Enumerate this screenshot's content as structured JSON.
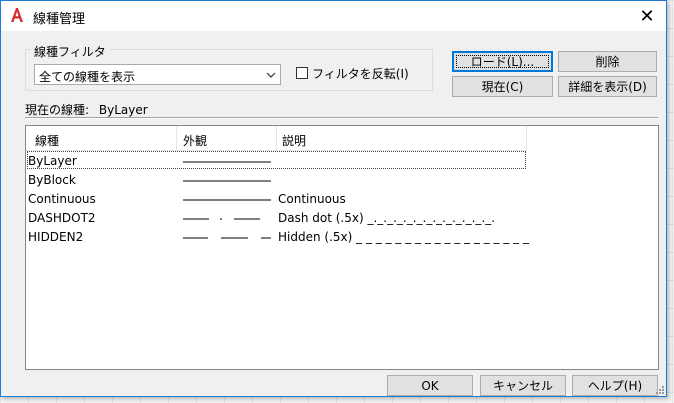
{
  "dialog": {
    "title": "線種管理",
    "close_label": "✕"
  },
  "filter": {
    "group_label": "線種フィルタ",
    "selected": "全ての線種を表示",
    "invert_label": "フィルタを反転(I)",
    "invert_checked": false
  },
  "buttons": {
    "load": "ロード(L)...",
    "delete": "削除",
    "current": "現在(C)",
    "details": "詳細を表示(D)",
    "ok": "OK",
    "cancel": "キャンセル",
    "help": "ヘルプ(H)"
  },
  "current_linetype": {
    "label": "現在の線種:",
    "value": "ByLayer"
  },
  "table": {
    "columns": [
      "線種",
      "外観",
      "説明"
    ],
    "rows": [
      {
        "name": "ByLayer",
        "look": "solid",
        "desc": ""
      },
      {
        "name": "ByBlock",
        "look": "solid",
        "desc": ""
      },
      {
        "name": "Continuous",
        "look": "solid",
        "desc": "Continuous"
      },
      {
        "name": "DASHDOT2",
        "look": "dashdot",
        "desc": "Dash dot (.5x) _._._._._._._._._._._._._."
      },
      {
        "name": "HIDDEN2",
        "look": "hidden",
        "desc": "Hidden (.5x) _ _ _ _ _ _ _ _ _ _ _ _ _ _ _ _ _ _"
      }
    ]
  },
  "colors": {
    "accent": "#0078d7",
    "app_icon": "#d32f2f"
  },
  "icons": {
    "app": "autocad-logo-icon",
    "dropdown": "chevron-down-icon",
    "grip": "resize-grip-icon"
  }
}
